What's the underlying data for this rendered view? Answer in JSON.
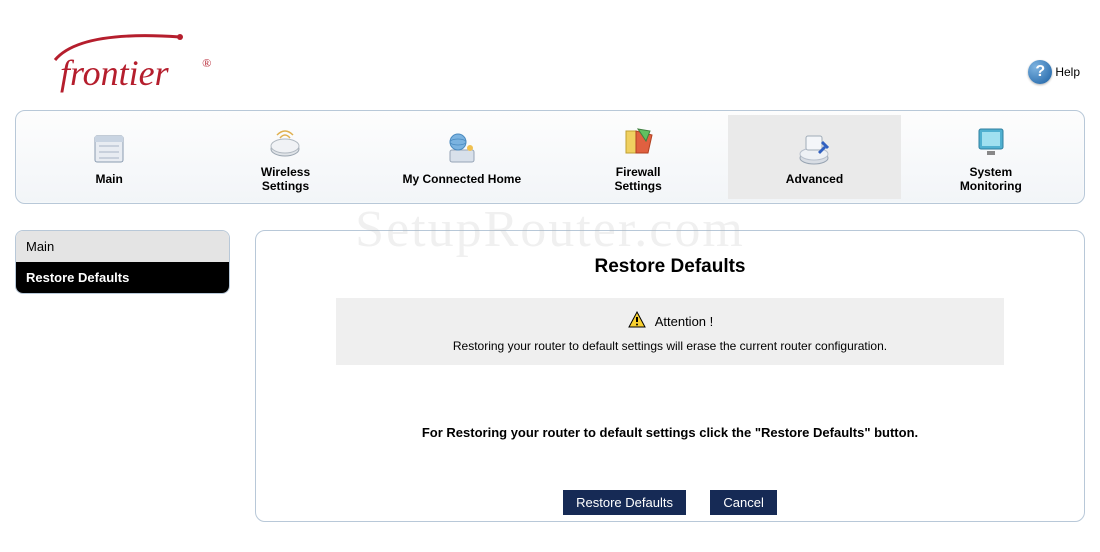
{
  "brand": "frontier",
  "help_label": "Help",
  "nav": {
    "tabs": [
      {
        "label": "Main",
        "icon": "calendar-icon"
      },
      {
        "label": "Wireless\nSettings",
        "icon": "router-icon"
      },
      {
        "label": "My Connected Home",
        "icon": "globe-icon"
      },
      {
        "label": "Firewall\nSettings",
        "icon": "shield-icon"
      },
      {
        "label": "Advanced",
        "icon": "device-icon",
        "active": true
      },
      {
        "label": "System\nMonitoring",
        "icon": "monitor-icon"
      }
    ]
  },
  "sidebar": {
    "items": [
      {
        "label": "Main",
        "klass": "main"
      },
      {
        "label": "Restore Defaults",
        "klass": "selected"
      }
    ]
  },
  "content": {
    "title": "Restore Defaults",
    "attention_label": "Attention !",
    "attention_text": "Restoring your router to default settings will erase the current router configuration.",
    "instruction": "For Restoring your router to default settings click the \"Restore Defaults\" button.",
    "buttons": {
      "restore": "Restore Defaults",
      "cancel": "Cancel"
    }
  },
  "watermark": "SetupRouter.com"
}
